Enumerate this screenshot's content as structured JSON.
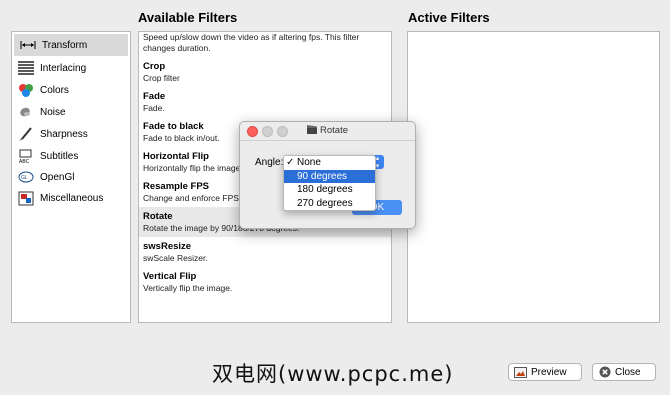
{
  "headings": {
    "available": "Available Filters",
    "active": "Active Filters"
  },
  "categories": [
    {
      "label": "Transform",
      "icon": "transform-icon",
      "selected": true
    },
    {
      "label": "Interlacing",
      "icon": "interlacing-icon"
    },
    {
      "label": "Colors",
      "icon": "colors-icon"
    },
    {
      "label": "Noise",
      "icon": "noise-icon"
    },
    {
      "label": "Sharpness",
      "icon": "sharpness-icon"
    },
    {
      "label": "Subtitles",
      "icon": "subtitles-icon"
    },
    {
      "label": "OpenGl",
      "icon": "opengl-icon"
    },
    {
      "label": "Miscellaneous",
      "icon": "miscellaneous-icon"
    }
  ],
  "filters": {
    "top_description": "Speed up/slow down the video as if altering fps. This filter changes duration.",
    "items": [
      {
        "name": "Crop",
        "desc": "Crop filter"
      },
      {
        "name": "Fade",
        "desc": "Fade."
      },
      {
        "name": "Fade to black",
        "desc": "Fade to black in/out."
      },
      {
        "name": "Horizontal Flip",
        "desc": "Horizontally flip the image."
      },
      {
        "name": "Resample FPS",
        "desc": "Change and enforce FPS."
      },
      {
        "name": "Rotate",
        "desc": "Rotate the image by 90/180/270 degrees."
      },
      {
        "name": "swsResize",
        "desc": "swScale Resizer."
      },
      {
        "name": "Vertical Flip",
        "desc": "Vertically flip the image."
      }
    ]
  },
  "dialog": {
    "title": "Rotate",
    "angle_label": "Angle:",
    "ok_label": "OK",
    "options": [
      {
        "label": "None",
        "checked": true
      },
      {
        "label": "90 degrees",
        "highlighted": true
      },
      {
        "label": "180 degrees"
      },
      {
        "label": "270 degrees"
      }
    ]
  },
  "footer": {
    "watermark": "双电网(www.pcpc.me)",
    "preview_label": "Preview",
    "close_label": "Close"
  },
  "colors": {
    "accent": "#3d85f2",
    "highlight": "#2a6ed8",
    "traffic_red": "#fc605c"
  }
}
